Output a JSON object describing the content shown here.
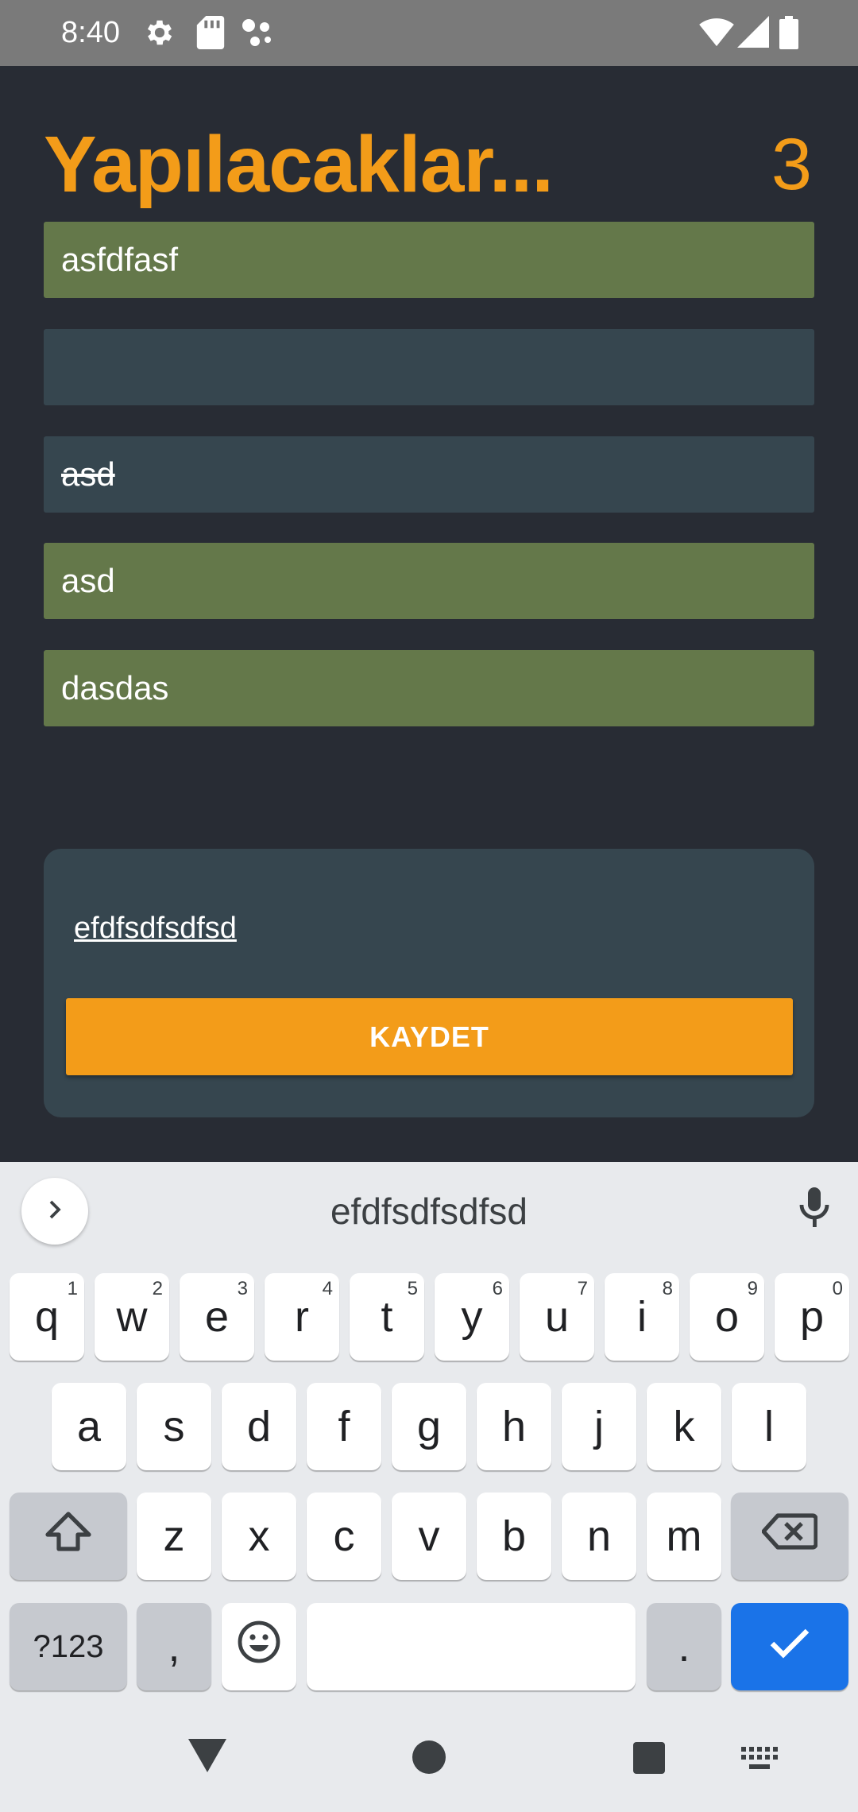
{
  "status_bar": {
    "time": "8:40"
  },
  "app": {
    "title": "Yapılacaklar...",
    "count": "3",
    "todos": [
      {
        "text": "asfdfasf",
        "status": "done"
      },
      {
        "text": "",
        "status": "pending"
      },
      {
        "text": "asd",
        "status": "pending-struck"
      },
      {
        "text": "asd",
        "status": "done"
      },
      {
        "text": "dasdas",
        "status": "done"
      }
    ],
    "input_value": "efdfsdfsdfsd",
    "save_label": "KAYDET"
  },
  "keyboard": {
    "suggestion": "efdfsdfsdfsd",
    "row1": [
      {
        "k": "q",
        "n": "1"
      },
      {
        "k": "w",
        "n": "2"
      },
      {
        "k": "e",
        "n": "3"
      },
      {
        "k": "r",
        "n": "4"
      },
      {
        "k": "t",
        "n": "5"
      },
      {
        "k": "y",
        "n": "6"
      },
      {
        "k": "u",
        "n": "7"
      },
      {
        "k": "i",
        "n": "8"
      },
      {
        "k": "o",
        "n": "9"
      },
      {
        "k": "p",
        "n": "0"
      }
    ],
    "row2": [
      "a",
      "s",
      "d",
      "f",
      "g",
      "h",
      "j",
      "k",
      "l"
    ],
    "row3": [
      "z",
      "x",
      "c",
      "v",
      "b",
      "n",
      "m"
    ],
    "symbols_label": "?123",
    "comma_label": ",",
    "period_label": "."
  },
  "colors": {
    "accent": "#f39c19",
    "background": "#282c34",
    "done_row": "#64784a",
    "pending_row": "#36464f",
    "keyboard_action": "#1a73e8"
  }
}
